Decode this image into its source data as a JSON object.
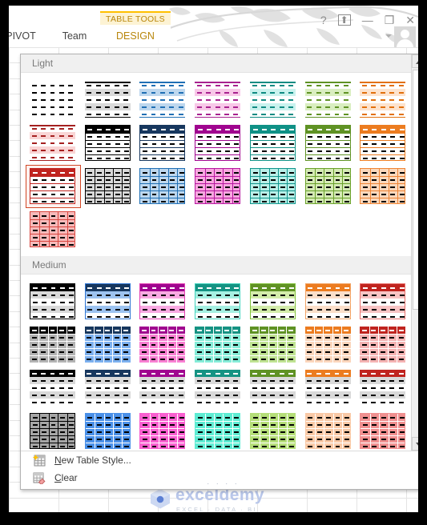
{
  "window": {
    "context_tab_label": "TABLE TOOLS",
    "tabs": [
      {
        "label": "PIVOT",
        "active": false
      },
      {
        "label": "Team",
        "active": false
      },
      {
        "label": "DESIGN",
        "active": true
      }
    ],
    "controls": [
      {
        "name": "help-icon",
        "glyph": "?"
      },
      {
        "name": "ribbon-display-options-icon",
        "glyph": "⬆"
      },
      {
        "name": "minimize-icon",
        "glyph": "—"
      },
      {
        "name": "restore-icon",
        "glyph": "❐"
      },
      {
        "name": "close-icon",
        "glyph": "✕"
      }
    ]
  },
  "gallery": {
    "sections": [
      {
        "title": "Light",
        "rows": [
          [
            {
              "name": "table-style-light-1",
              "header": "#ffffff",
              "band": "#ffffff",
              "line": "#000000",
              "dash": "#000000",
              "mode": "plain"
            },
            {
              "name": "table-style-light-2",
              "header": "#ffffff",
              "band": "#d9d9d9",
              "line": "#000000",
              "dash": "#000000",
              "mode": "banded"
            },
            {
              "name": "table-style-light-3",
              "header": "#ffffff",
              "band": "#bdd7ee",
              "line": "#1f6fb4",
              "dash": "#1f6fb4",
              "mode": "banded"
            },
            {
              "name": "table-style-light-4",
              "header": "#ffffff",
              "band": "#f8c8e8",
              "line": "#a8228f",
              "dash": "#a8228f",
              "mode": "banded"
            },
            {
              "name": "table-style-light-5",
              "header": "#ffffff",
              "band": "#c9f2ee",
              "line": "#0e8b82",
              "dash": "#0e8b82",
              "mode": "banded"
            },
            {
              "name": "table-style-light-6",
              "header": "#ffffff",
              "band": "#d9eec0",
              "line": "#5f9224",
              "dash": "#5f9224",
              "mode": "banded"
            },
            {
              "name": "table-style-light-7",
              "header": "#ffffff",
              "band": "#fde3cd",
              "line": "#e2700c",
              "dash": "#e2700c",
              "mode": "banded"
            }
          ],
          [
            {
              "name": "table-style-light-8",
              "header": "#ffffff",
              "band": "#f9d5d5",
              "line": "#a52020",
              "dash": "#a52020",
              "mode": "banded"
            },
            {
              "name": "table-style-light-9",
              "header": "#000000",
              "band": "#ffffff",
              "line": "#000000",
              "dash": "#000000",
              "mode": "header"
            },
            {
              "name": "table-style-light-10",
              "header": "#17375e",
              "band": "#ffffff",
              "line": "#17375e",
              "dash": "#000000",
              "mode": "header"
            },
            {
              "name": "table-style-light-11",
              "header": "#a0058f",
              "band": "#ffffff",
              "line": "#a0058f",
              "dash": "#000000",
              "mode": "header"
            },
            {
              "name": "table-style-light-12",
              "header": "#0f9186",
              "band": "#ffffff",
              "line": "#0f9186",
              "dash": "#000000",
              "mode": "header"
            },
            {
              "name": "table-style-light-13",
              "header": "#5f9224",
              "band": "#ffffff",
              "line": "#5f9224",
              "dash": "#000000",
              "mode": "header"
            },
            {
              "name": "table-style-light-14",
              "header": "#ec7c20",
              "band": "#ffffff",
              "line": "#ec7c20",
              "dash": "#000000",
              "mode": "header"
            }
          ],
          [
            {
              "name": "table-style-light-15",
              "header": "#c0241f",
              "band": "#ffffff",
              "line": "#c0241f",
              "dash": "#000000",
              "mode": "header",
              "selected": true
            },
            {
              "name": "table-style-light-16",
              "header": "#d9d9d9",
              "band": "#d9d9d9",
              "line": "#000000",
              "dash": "#000000",
              "mode": "grid"
            },
            {
              "name": "table-style-light-17",
              "header": "#bdd7ee",
              "band": "#bdd7ee",
              "line": "#1f6fb4",
              "dash": "#000000",
              "mode": "grid"
            },
            {
              "name": "table-style-light-18",
              "header": "#f8a7e0",
              "band": "#f8a7e0",
              "line": "#b6179f",
              "dash": "#000000",
              "mode": "grid"
            },
            {
              "name": "table-style-light-19",
              "header": "#b9efe8",
              "band": "#b9efe8",
              "line": "#10958c",
              "dash": "#000000",
              "mode": "grid"
            },
            {
              "name": "table-style-light-20",
              "header": "#d5eab5",
              "band": "#d5eab5",
              "line": "#6aa12a",
              "dash": "#000000",
              "mode": "grid"
            },
            {
              "name": "table-style-light-21",
              "header": "#fad8bc",
              "band": "#fad8bc",
              "line": "#ef8535",
              "dash": "#000000",
              "mode": "grid"
            }
          ],
          [
            {
              "name": "table-style-light-22",
              "header": "#f6baba",
              "band": "#f6baba",
              "line": "#d9463f",
              "dash": "#000000",
              "mode": "grid"
            }
          ]
        ]
      },
      {
        "title": "Medium",
        "rows": [
          [
            {
              "name": "table-style-medium-1",
              "header": "#000000",
              "band": "#d9d9d9",
              "line": "#000000",
              "dash": "#000000",
              "mode": "hdrband"
            },
            {
              "name": "table-style-medium-2",
              "header": "#17375e",
              "band": "#9dc3f0",
              "line": "#2e75d4",
              "dash": "#000000",
              "mode": "hdrband"
            },
            {
              "name": "table-style-medium-3",
              "header": "#a0058f",
              "band": "#f9a9e2",
              "line": "#e342b4",
              "dash": "#000000",
              "mode": "hdrband"
            },
            {
              "name": "table-style-medium-4",
              "header": "#159383",
              "band": "#a6f0e2",
              "line": "#3ed4bd",
              "dash": "#000000",
              "mode": "hdrband"
            },
            {
              "name": "table-style-medium-5",
              "header": "#5f9224",
              "band": "#d3ecaa",
              "line": "#82c13c",
              "dash": "#000000",
              "mode": "hdrband"
            },
            {
              "name": "table-style-medium-6",
              "header": "#ec7c20",
              "band": "#fbdfca",
              "line": "#f2a263",
              "dash": "#000000",
              "mode": "hdrband"
            },
            {
              "name": "table-style-medium-7",
              "header": "#c0241f",
              "band": "#f8c4c4",
              "line": "#e8716c",
              "dash": "#000000",
              "mode": "hdrband"
            }
          ],
          [
            {
              "name": "table-style-medium-8",
              "header": "#000000",
              "band": "#b3b3b3",
              "line": "#ffffff",
              "dash": "#000000",
              "mode": "fillband"
            },
            {
              "name": "table-style-medium-9",
              "header": "#17375e",
              "band": "#7cb0ef",
              "line": "#ffffff",
              "dash": "#000000",
              "mode": "fillband"
            },
            {
              "name": "table-style-medium-10",
              "header": "#a0058f",
              "band": "#f87fd2",
              "line": "#ffffff",
              "dash": "#000000",
              "mode": "fillband"
            },
            {
              "name": "table-style-medium-11",
              "header": "#159383",
              "band": "#85ecd8",
              "line": "#ffffff",
              "dash": "#000000",
              "mode": "fillband"
            },
            {
              "name": "table-style-medium-12",
              "header": "#5f9224",
              "band": "#bfe392",
              "line": "#ffffff",
              "dash": "#000000",
              "mode": "fillband"
            },
            {
              "name": "table-style-medium-13",
              "header": "#ec7c20",
              "band": "#fbd6bc",
              "line": "#ffffff",
              "dash": "#000000",
              "mode": "fillband"
            },
            {
              "name": "table-style-medium-14",
              "header": "#c0241f",
              "band": "#f4b3b3",
              "line": "#ffffff",
              "dash": "#000000",
              "mode": "fillband"
            }
          ],
          [
            {
              "name": "table-style-medium-15",
              "header": "#000000",
              "band": "#d9d9d9",
              "line": "#000000",
              "dash": "#000000",
              "mode": "greyband"
            },
            {
              "name": "table-style-medium-16",
              "header": "#17375e",
              "band": "#d9d9d9",
              "line": "#ffffff",
              "dash": "#000000",
              "mode": "greyband"
            },
            {
              "name": "table-style-medium-17",
              "header": "#a0058f",
              "band": "#d9d9d9",
              "line": "#ffffff",
              "dash": "#000000",
              "mode": "greyband"
            },
            {
              "name": "table-style-medium-18",
              "header": "#159383",
              "band": "#d9d9d9",
              "line": "#ffffff",
              "dash": "#000000",
              "mode": "greyband"
            },
            {
              "name": "table-style-medium-19",
              "header": "#5f9224",
              "band": "#d9d9d9",
              "line": "#ffffff",
              "dash": "#000000",
              "mode": "greyband"
            },
            {
              "name": "table-style-medium-20",
              "header": "#ec7c20",
              "band": "#d9d9d9",
              "line": "#ffffff",
              "dash": "#000000",
              "mode": "greyband"
            },
            {
              "name": "table-style-medium-21",
              "header": "#c0241f",
              "band": "#d9d9d9",
              "line": "#ffffff",
              "dash": "#000000",
              "mode": "greyband"
            }
          ],
          [
            {
              "name": "table-style-medium-22",
              "header": "#a6a6a6",
              "band": "#a6a6a6",
              "line": "#000000",
              "dash": "#000000",
              "mode": "grid"
            },
            {
              "name": "table-style-medium-23",
              "header": "#4a90e8",
              "band": "#4a90e8",
              "line": "#ffffff",
              "dash": "#000000",
              "mode": "grid"
            },
            {
              "name": "table-style-medium-24",
              "header": "#f95fd0",
              "band": "#f95fd0",
              "line": "#ffffff",
              "dash": "#000000",
              "mode": "grid"
            },
            {
              "name": "table-style-medium-25",
              "header": "#5eecd3",
              "band": "#5eecd3",
              "line": "#ffffff",
              "dash": "#000000",
              "mode": "grid"
            },
            {
              "name": "table-style-medium-26",
              "header": "#b5de78",
              "band": "#b5de78",
              "line": "#ffffff",
              "dash": "#000000",
              "mode": "grid"
            },
            {
              "name": "table-style-medium-27",
              "header": "#f9c9a6",
              "band": "#f9c9a6",
              "line": "#ffffff",
              "dash": "#000000",
              "mode": "grid"
            },
            {
              "name": "table-style-medium-28",
              "header": "#f09090",
              "band": "#f09090",
              "line": "#ffffff",
              "dash": "#000000",
              "mode": "grid"
            }
          ]
        ]
      }
    ],
    "commands": [
      {
        "name": "new-table-style-command",
        "accel": "N",
        "rest": "ew Table Style...",
        "icon": "new-table-style-icon"
      },
      {
        "name": "clear-command",
        "accel": "C",
        "rest": "lear",
        "icon": "clear-eraser-icon"
      }
    ],
    "grip": "· · · ·"
  },
  "watermark": {
    "text": "exceldemy",
    "tagline": "EXCEL · DATA · BI"
  }
}
